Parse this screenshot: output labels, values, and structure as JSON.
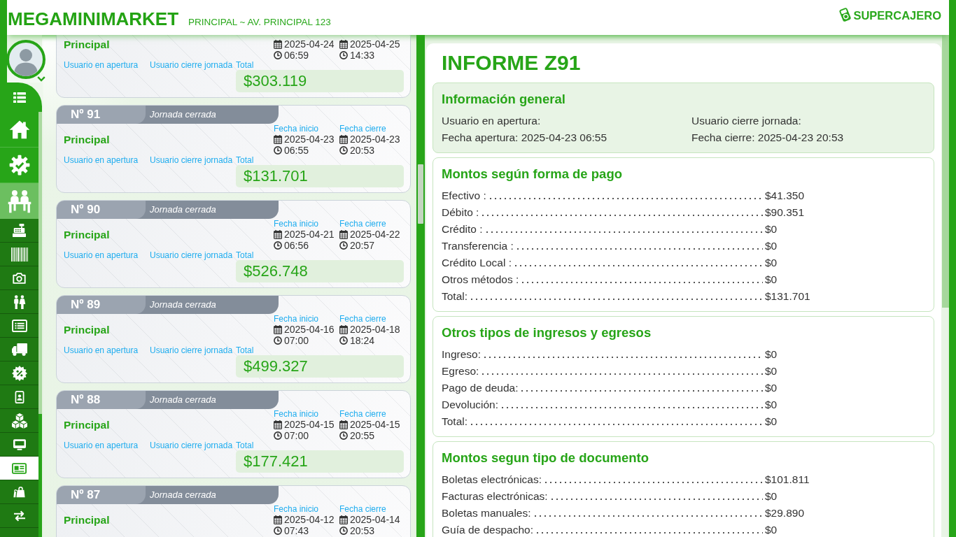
{
  "header": {
    "store": "MEGAMINIMARKET",
    "branch": "PRINCIPAL ~ AV. PRINCIPAL 123",
    "brand": "SUPERCAJERO"
  },
  "sidebar": {
    "items": [
      {
        "selected": false
      },
      {
        "selected": false
      },
      {
        "selected": false,
        "expanded": true,
        "children": [
          {
            "selected": false
          },
          {
            "selected": false
          },
          {
            "selected": false
          },
          {
            "selected": false
          },
          {
            "selected": false
          },
          {
            "selected": false
          },
          {
            "selected": false
          },
          {
            "selected": false
          },
          {
            "selected": false
          },
          {
            "selected": false
          },
          {
            "selected": true
          },
          {
            "selected": false
          },
          {
            "selected": false
          }
        ]
      }
    ]
  },
  "shifts": [
    {
      "branch": "Principal",
      "start_date": "2025-04-24",
      "start_time": "06:59",
      "end_date": "2025-04-25",
      "end_time": "14:33",
      "opening_user_label": "Usuario en apertura",
      "closing_user_label": "Usuario cierre jornada",
      "total_label": "Total",
      "total": "$303.119"
    },
    {
      "number": "Nº 91",
      "status": "Jornada cerrada",
      "branch": "Principal",
      "start_label": "Fecha inicio",
      "start_date": "2025-04-23",
      "start_time": "06:55",
      "end_label": "Fecha cierre",
      "end_date": "2025-04-23",
      "end_time": "20:53",
      "opening_user_label": "Usuario en apertura",
      "closing_user_label": "Usuario cierre jornada",
      "total_label": "Total",
      "total": "$131.701"
    },
    {
      "number": "Nº 90",
      "status": "Jornada cerrada",
      "branch": "Principal",
      "start_label": "Fecha inicio",
      "start_date": "2025-04-21",
      "start_time": "06:56",
      "end_label": "Fecha cierre",
      "end_date": "2025-04-22",
      "end_time": "20:57",
      "opening_user_label": "Usuario en apertura",
      "closing_user_label": "Usuario cierre jornada",
      "total_label": "Total",
      "total": "$526.748"
    },
    {
      "number": "Nº 89",
      "status": "Jornada cerrada",
      "branch": "Principal",
      "start_label": "Fecha inicio",
      "start_date": "2025-04-16",
      "start_time": "07:00",
      "end_label": "Fecha cierre",
      "end_date": "2025-04-18",
      "end_time": "18:24",
      "opening_user_label": "Usuario en apertura",
      "closing_user_label": "Usuario cierre jornada",
      "total_label": "Total",
      "total": "$499.327"
    },
    {
      "number": "Nº 88",
      "status": "Jornada cerrada",
      "branch": "Principal",
      "start_label": "Fecha inicio",
      "start_date": "2025-04-15",
      "start_time": "07:00",
      "end_label": "Fecha cierre",
      "end_date": "2025-04-15",
      "end_time": "20:55",
      "opening_user_label": "Usuario en apertura",
      "closing_user_label": "Usuario cierre jornada",
      "total_label": "Total",
      "total": "$177.421"
    },
    {
      "number": "Nº 87",
      "status": "Jornada cerrada",
      "branch": "Principal",
      "start_label": "Fecha inicio",
      "start_date": "2025-04-12",
      "start_time": "07:43",
      "end_label": "Fecha cierre",
      "end_date": "2025-04-14",
      "end_time": "20:53"
    }
  ],
  "report": {
    "title": "INFORME Z91",
    "sections": [
      {
        "kind": "info",
        "heading": "Información general",
        "fields": [
          "Usuario en apertura:",
          "Usuario cierre jornada:",
          "Fecha apertura: 2025-04-23 06:55",
          "Fecha cierre: 2025-04-23 20:53"
        ]
      },
      {
        "kind": "amounts",
        "heading": "Montos según forma de pago",
        "rows": [
          {
            "label": "Efectivo :",
            "value": "$41.350"
          },
          {
            "label": "Débito :",
            "value": "$90.351"
          },
          {
            "label": "Crédito :",
            "value": "$0"
          },
          {
            "label": "Transferencia :",
            "value": "$0"
          },
          {
            "label": "Crédito Local :",
            "value": "$0"
          },
          {
            "label": "Otros métodos :",
            "value": "$0"
          },
          {
            "label": "Total:",
            "value": "$131.701"
          }
        ]
      },
      {
        "kind": "amounts",
        "heading": "Otros tipos de ingresos y egresos",
        "rows": [
          {
            "label": "Ingreso:",
            "value": "$0"
          },
          {
            "label": "Egreso:",
            "value": "$0"
          },
          {
            "label": "Pago de deuda:",
            "value": "$0"
          },
          {
            "label": "Devolución:",
            "value": "$0"
          },
          {
            "label": "Total:",
            "value": "$0"
          }
        ]
      },
      {
        "kind": "amounts",
        "heading": "Montos segun tipo de documento",
        "rows": [
          {
            "label": "Boletas electrónicas:",
            "value": "$101.811"
          },
          {
            "label": "Facturas electrónicas:",
            "value": "$0"
          },
          {
            "label": "Boletas manuales:",
            "value": "$29.890"
          },
          {
            "label": "Guía de despacho:",
            "value": "$0"
          }
        ]
      }
    ]
  }
}
